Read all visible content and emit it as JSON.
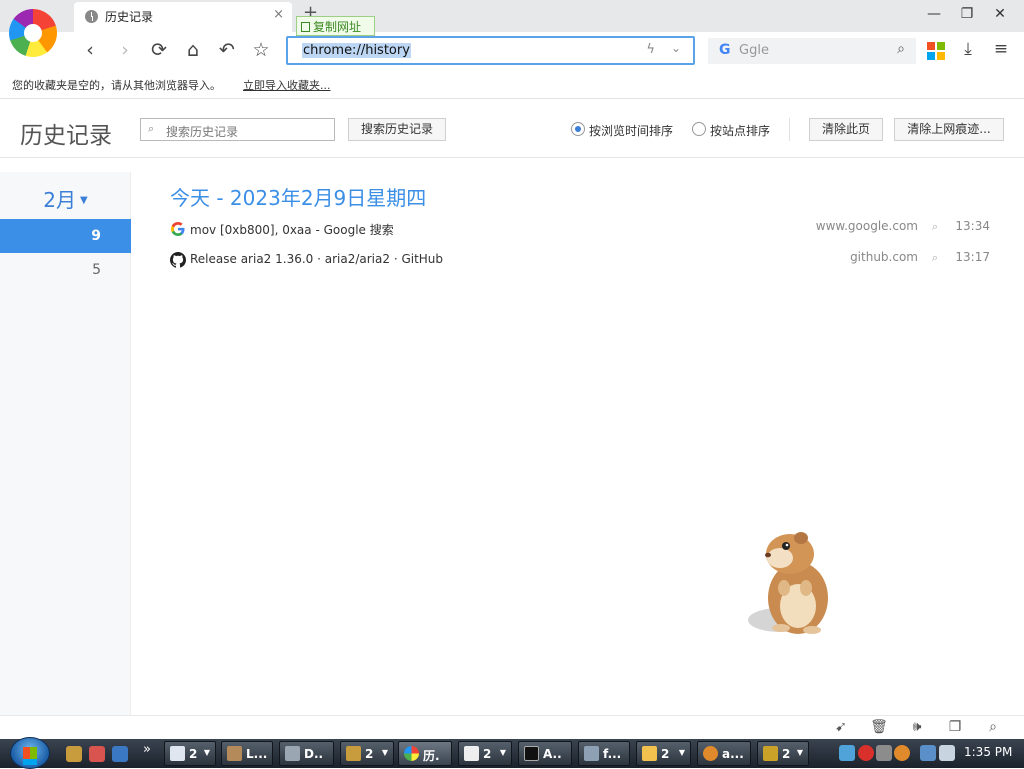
{
  "browser": {
    "tab_title": "历史记录",
    "tab_close": "×",
    "new_tab": "+",
    "copy_url_tip": "复制网址",
    "address_text": "chrome://history",
    "search_engine_logo": "G",
    "search_placeholder": "Ggle",
    "window_controls": {
      "minimize": "—",
      "restore": "❐",
      "close": "✕"
    }
  },
  "bookmark_bar": {
    "empty_message": "您的收藏夹是空的，请从其他浏览器导入。",
    "import_link": "立即导入收藏夹..."
  },
  "history": {
    "title": "历史记录",
    "search_placeholder": "搜索历史记录",
    "search_button": "搜索历史记录",
    "sort_by_time": "按浏览时间排序",
    "sort_by_site": "按站点排序",
    "sort_selected": "time",
    "clear_page_button": "清除此页",
    "clear_traces_button": "清除上网痕迹...",
    "month_label": "2月",
    "days": [
      "9",
      "5"
    ],
    "selected_day": "9",
    "date_heading": "今天 - 2023年2月9日星期四",
    "entries": [
      {
        "icon": "google-icon",
        "title": "mov [0xb800], 0xaa - Google 搜索",
        "domain": "www.google.com",
        "time": "13:34"
      },
      {
        "icon": "github-icon",
        "title": "Release aria2 1.36.0 · aria2/aria2 · GitHub",
        "domain": "github.com",
        "time": "13:17"
      }
    ]
  },
  "taskbar": {
    "tasks": [
      {
        "label": "2",
        "icon": "window-icon",
        "has_menu": true
      },
      {
        "label": "L...",
        "icon": "app-icon",
        "has_menu": false
      },
      {
        "label": "D..",
        "icon": "app-icon",
        "has_menu": false
      },
      {
        "label": "2",
        "icon": "app-icon",
        "has_menu": true
      },
      {
        "label": "历.",
        "icon": "browser-icon",
        "has_menu": false,
        "active": true
      },
      {
        "label": "2",
        "icon": "app-icon",
        "has_menu": true
      },
      {
        "label": "A..",
        "icon": "cmd-icon",
        "has_menu": false
      },
      {
        "label": "f...",
        "icon": "app-icon",
        "has_menu": false
      },
      {
        "label": "2",
        "icon": "folder-icon",
        "has_menu": true
      },
      {
        "label": "a...",
        "icon": "search-app-icon",
        "has_menu": false
      },
      {
        "label": "2",
        "icon": "dos-icon",
        "has_menu": true
      }
    ],
    "clock": "1:35 PM"
  },
  "colors": {
    "accent_blue": "#3c8fe6",
    "address_border": "#5aa3e8",
    "taskbar_dark": "#1b222b"
  }
}
